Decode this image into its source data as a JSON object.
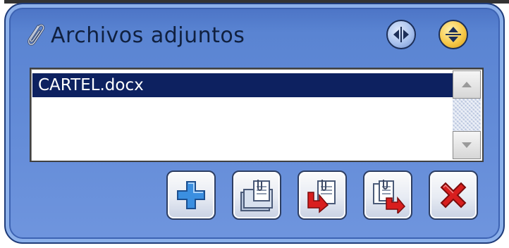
{
  "window": {
    "title": "Archivos adjuntos"
  },
  "header": {
    "icons": [
      "paperclip-icon",
      "expand-horizontal-icon",
      "expand-vertical-icon"
    ]
  },
  "attachments": {
    "items": [
      {
        "label": "CARTEL.docx",
        "selected": true
      }
    ]
  },
  "toolbar": {
    "buttons": [
      {
        "icon": "add-icon"
      },
      {
        "icon": "open-attachment-icon"
      },
      {
        "icon": "save-attachment-icon"
      },
      {
        "icon": "save-all-attachments-icon"
      },
      {
        "icon": "delete-icon"
      }
    ]
  },
  "colors": {
    "panel": "#5a84d2",
    "selection": "#0d2160",
    "accent_orange": "#f7c94a",
    "delete_red": "#d81e1e",
    "add_blue": "#3b8fe0"
  }
}
